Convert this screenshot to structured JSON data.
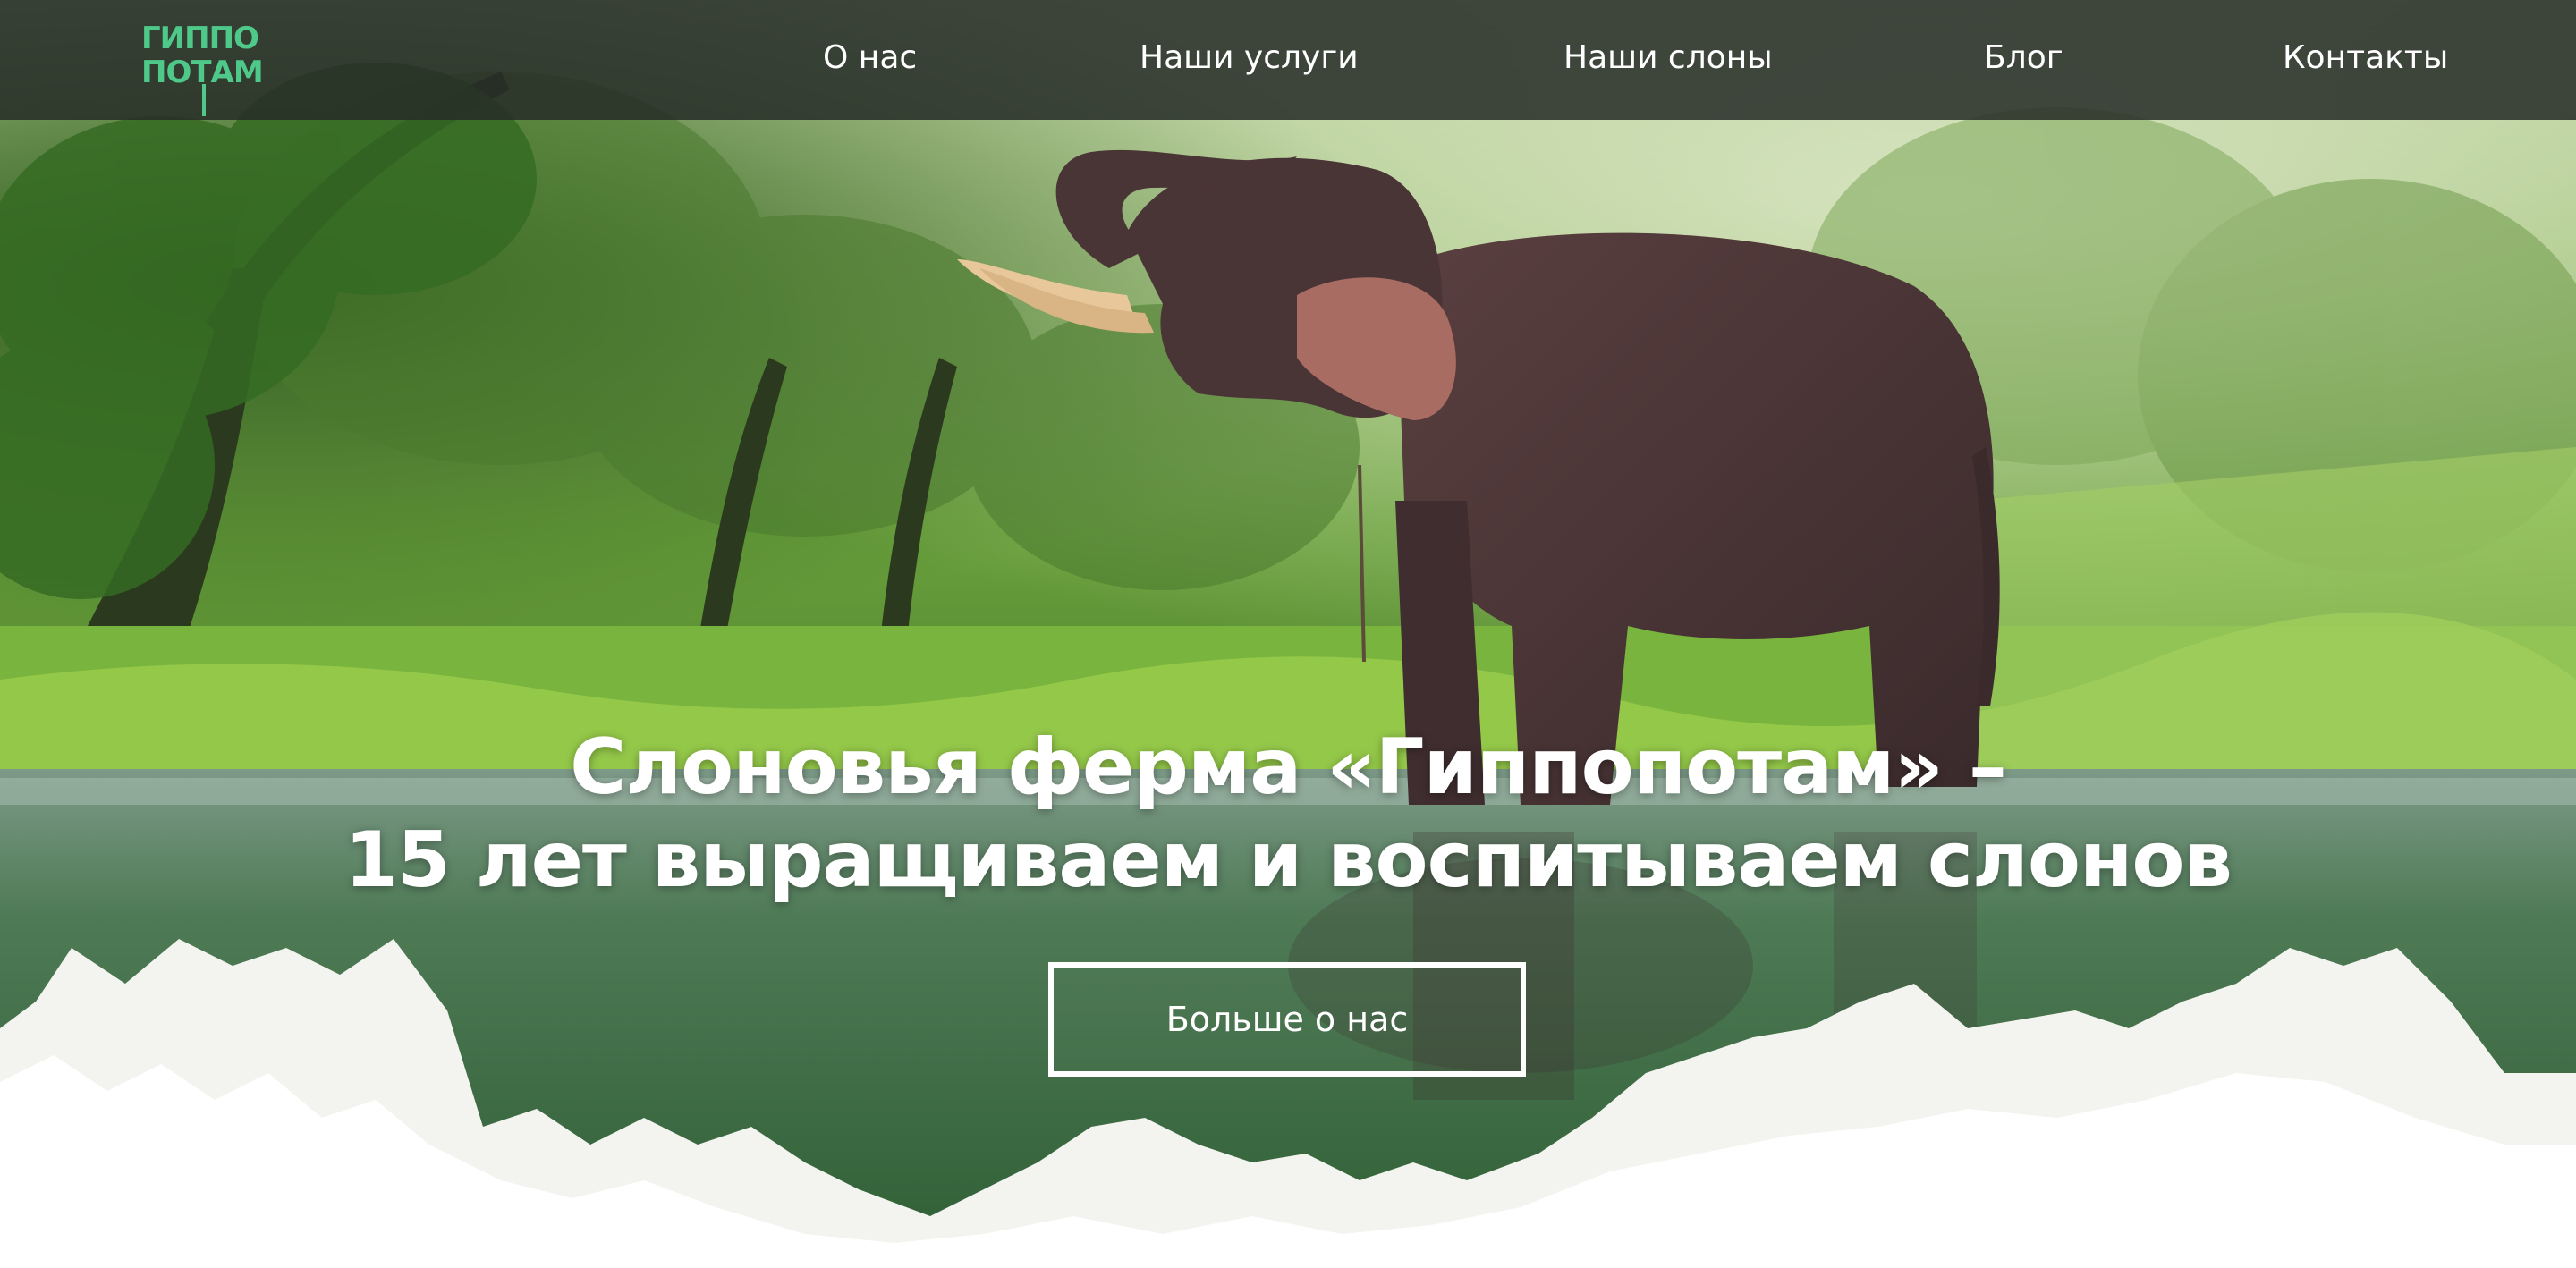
{
  "logo": {
    "line1": "ГИППО",
    "line2": "ПОТАМ",
    "color": "#4fc98a"
  },
  "nav": {
    "items": [
      {
        "label": "О нас"
      },
      {
        "label": "Наши услуги"
      },
      {
        "label": "Наши слоны"
      },
      {
        "label": "Блог"
      },
      {
        "label": "Контакты"
      }
    ]
  },
  "hero": {
    "title_line1": "Слоновья ферма «Гиппопотам» –",
    "title_line2": "15 лет выращиваем и воспитываем слонов",
    "cta_label": "Больше о нас",
    "image": "elephant-in-jungle-river"
  },
  "colors": {
    "header_bg": "#262c28",
    "accent": "#4fc98a",
    "text": "#ffffff"
  }
}
